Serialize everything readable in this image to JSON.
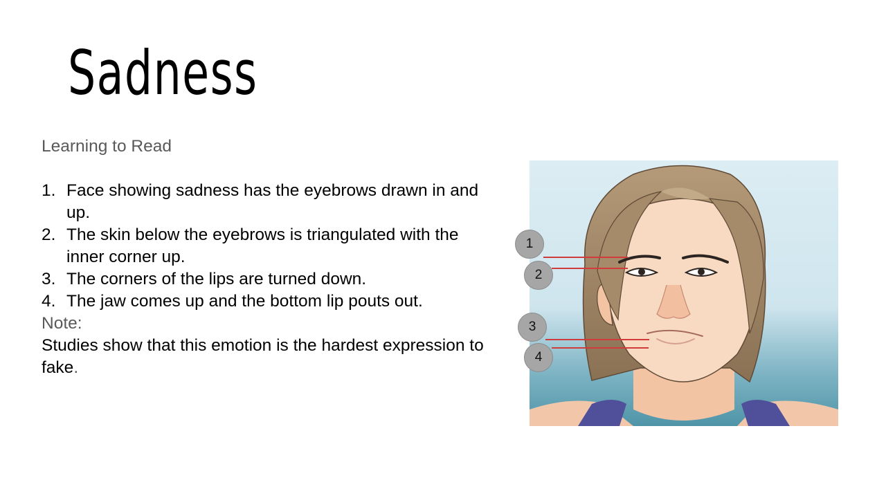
{
  "slide": {
    "title": "Sadness",
    "subtitle": "Learning to Read",
    "points": [
      {
        "num": "1.",
        "text": " Face showing sadness has the eyebrows drawn in and up."
      },
      {
        "num": "2.",
        "text": "The skin below the eyebrows is triangulated with the inner corner up."
      },
      {
        "num": "3.",
        "text": "The corners of the lips are turned down."
      },
      {
        "num": "4.",
        "text": "The jaw comes up and the bottom lip pouts out."
      }
    ],
    "note_label": "Note:",
    "note_text": "Studies show that this emotion is the hardest expression to fake",
    "note_end": "."
  },
  "illustration": {
    "callouts": [
      "1",
      "2",
      "3",
      "4"
    ]
  },
  "colors": {
    "callout_fill": "#a6a6a6",
    "callout_line": "#d23b3b",
    "muted_text": "#595959"
  }
}
